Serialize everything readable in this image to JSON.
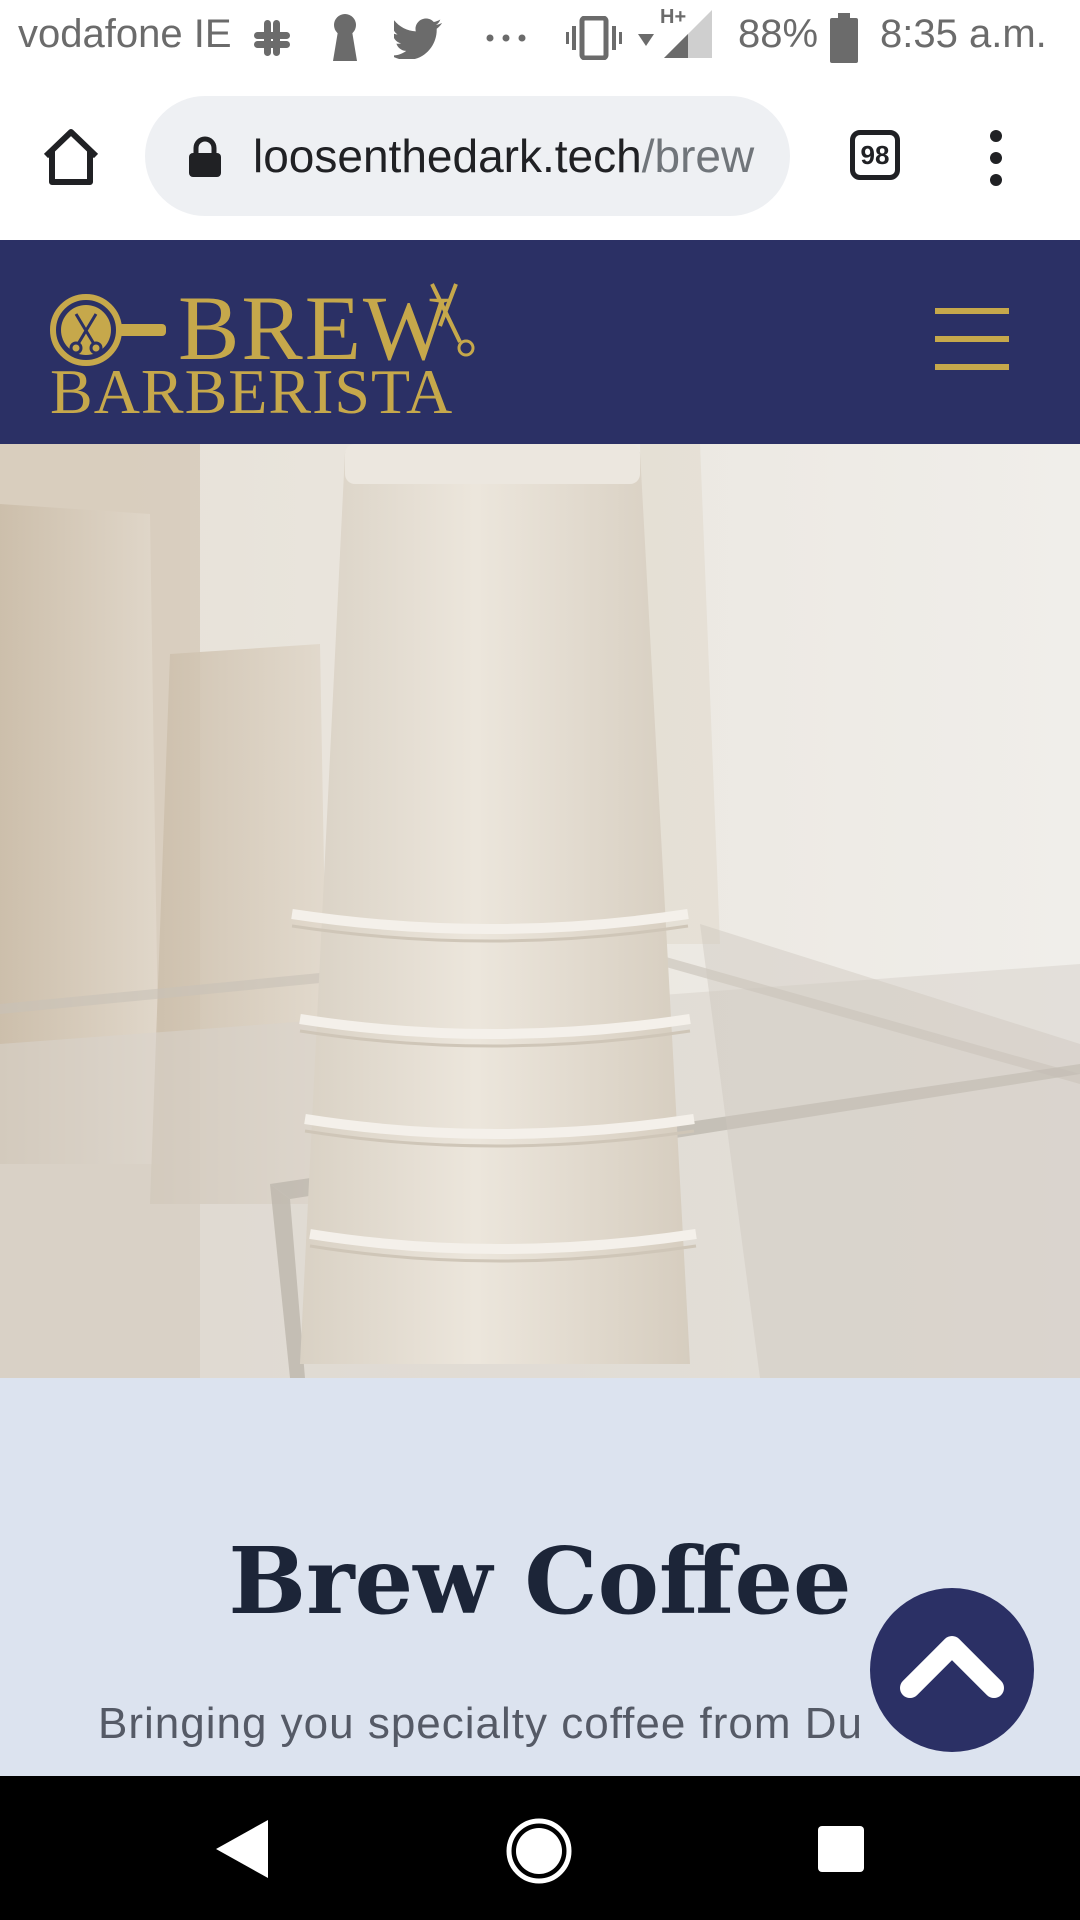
{
  "status_bar": {
    "carrier": "vodafone IE",
    "icons": [
      "slack-icon",
      "keyhole-icon",
      "twitter-icon",
      "more-notifications-icon",
      "vibrate-icon",
      "wifi-icon",
      "signal-icon",
      "battery-icon"
    ],
    "network_type": "H+",
    "battery_percent": "88%",
    "time": "8:35 a.m."
  },
  "browser": {
    "url_domain": "loosenthedark.tech",
    "url_path": "/brew",
    "tab_count": "98"
  },
  "site_header": {
    "logo_line1": "BREW",
    "logo_line2": "BARBERISTA",
    "brand_color": "#c6a84b",
    "header_color": "#2b3065"
  },
  "intro": {
    "title": "Brew Coffee",
    "subtitle": "Bringing you specialty coffee from Du"
  },
  "colors": {
    "intro_bg": "#dce3ef",
    "title_color": "#1c2538"
  }
}
